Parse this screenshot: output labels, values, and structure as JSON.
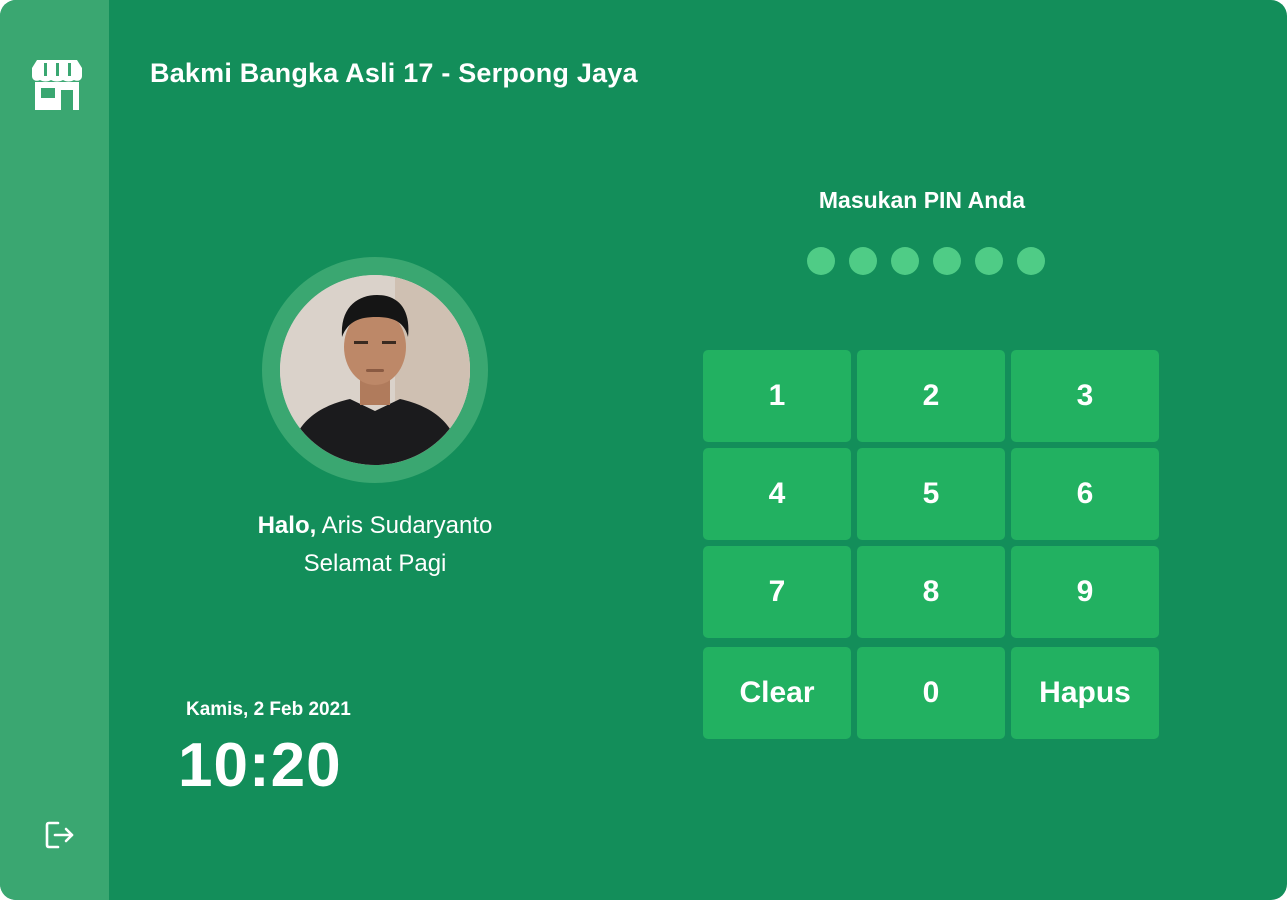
{
  "header": {
    "store_name": "Bakmi Bangka Asli 17 - Serpong Jaya"
  },
  "sidebar": {
    "logo_icon": "store-icon",
    "logout_icon": "logout-icon"
  },
  "user": {
    "greeting_prefix": "Halo,",
    "name": "Aris Sudaryanto",
    "salutation": "Selamat Pagi"
  },
  "datetime": {
    "date": "Kamis, 2 Feb 2021",
    "time": "10:20"
  },
  "pin": {
    "label": "Masukan PIN Anda",
    "length": 6,
    "entered": 0
  },
  "keypad": {
    "keys": [
      "1",
      "2",
      "3",
      "4",
      "5",
      "6",
      "7",
      "8",
      "9",
      "Clear",
      "0",
      "Hapus"
    ]
  },
  "colors": {
    "background": "#138e5a",
    "sidebar": "#3aa771",
    "key": "#22b161",
    "pin_dot": "#4fcc86"
  }
}
